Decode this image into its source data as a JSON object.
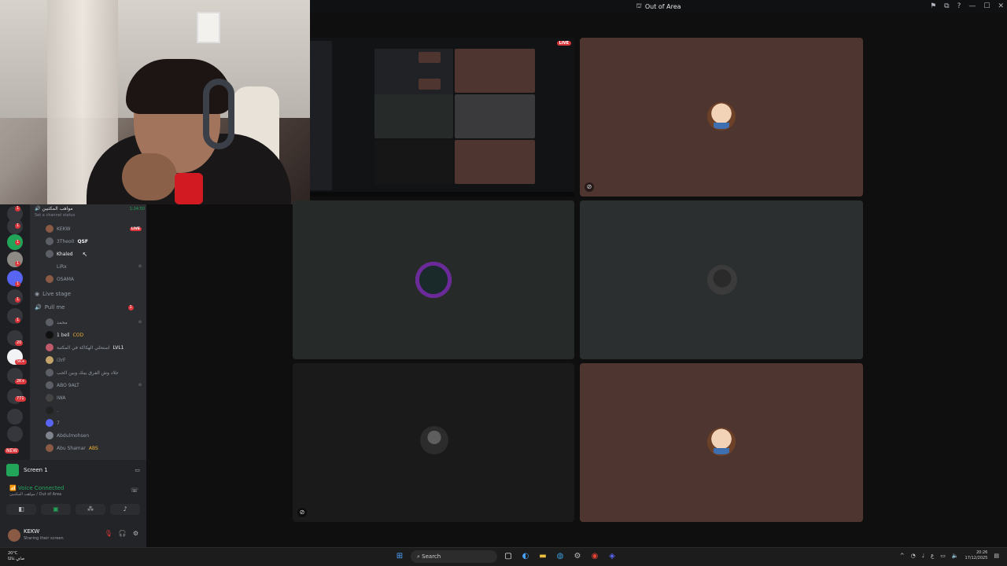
{
  "window": {
    "title": "Out of Area"
  },
  "webcam": {},
  "guild_badges": [
    "1",
    "1",
    "1",
    "1",
    "1",
    "1",
    "1",
    "20",
    "5K+",
    "2K+",
    "771",
    "NEW"
  ],
  "voice_channel": {
    "name": "مواهب المكتبين",
    "status_hint": "Set a channel status",
    "time": "1:24:50",
    "members": [
      {
        "name": "KEKW",
        "live": "LIVE"
      },
      {
        "name": "3Theo0",
        "tag": "QSF"
      },
      {
        "name": "Khaled"
      },
      {
        "name": "LiRx"
      },
      {
        "name": "OSAMA"
      }
    ]
  },
  "live_stage": "Live stage",
  "pull_me": {
    "name": "Pull me",
    "badge": "1",
    "members": [
      {
        "name": "محمد"
      },
      {
        "name": "1 bell",
        "tag": "COD"
      },
      {
        "name": "استحلي الهكاكة في المكتبة",
        "tag": "LVL1"
      },
      {
        "name": "i3rF"
      },
      {
        "name": "جلاد وش الفرق بينك وبين الحب"
      },
      {
        "name": "ABO 9ALT"
      },
      {
        "name": "IWA"
      },
      {
        "name": "."
      },
      {
        "name": "7"
      },
      {
        "name": "Abdulmohsen"
      },
      {
        "name": "Abu Shamar",
        "tag": "ABS"
      }
    ]
  },
  "panel": {
    "screen_label": "Screen 1",
    "voice_connected": "Voice Connected",
    "voice_location": "مواهب المكتبين / Out of Area",
    "user_name": "KEKW",
    "user_status": "Sharing their screen"
  },
  "stage": {
    "live_badge": "LIVE"
  },
  "taskbar": {
    "weather_temp": "20°C",
    "weather_desc": "صافٍ غالبًا",
    "search_placeholder": "Search",
    "time": "20:26",
    "date": "17/12/2025",
    "lang": "ع"
  }
}
